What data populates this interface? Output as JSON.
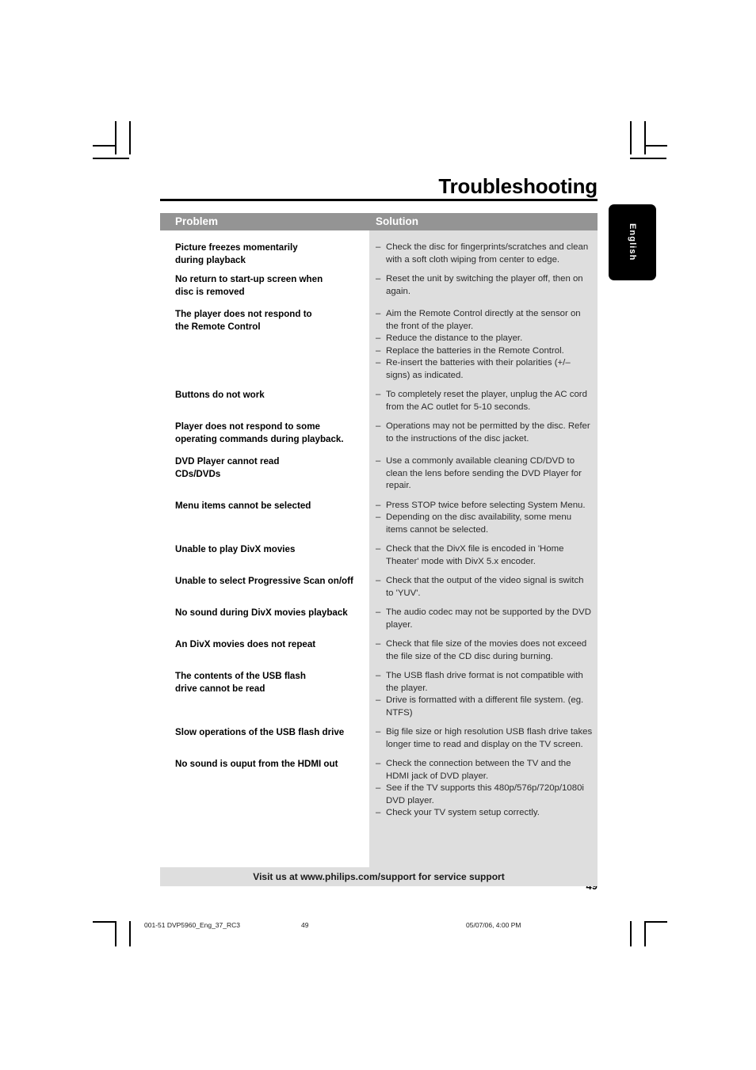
{
  "page": {
    "title": "Troubleshooting",
    "language_tab": "English",
    "page_number": "49"
  },
  "table": {
    "headers": {
      "problem": "Problem",
      "solution": "Solution"
    },
    "rows": [
      {
        "problem": "Picture freezes momentarily\nduring playback",
        "solutions": [
          "Check the disc for fingerprints/scratches and clean with a soft cloth wiping from center to edge."
        ]
      },
      {
        "problem": "No return to start-up screen when\ndisc is removed",
        "solutions": [
          "Reset the unit by switching the player off, then on again."
        ]
      },
      {
        "problem": "The player does not respond to\nthe Remote Control",
        "solutions": [
          "Aim the Remote Control directly at the sensor on the front of the player.",
          "Reduce the distance to the player.",
          "Replace the batteries in the Remote Control.",
          "Re-insert the batteries with their polarities (+/– signs) as indicated."
        ]
      },
      {
        "problem": "Buttons do not work",
        "solutions": [
          "To completely reset the player, unplug the AC cord from the AC outlet for 5-10 seconds."
        ]
      },
      {
        "problem": "Player does not respond to some\noperating commands during playback.",
        "solutions": [
          "Operations may not be permitted by the disc. Refer to the instructions of  the disc jacket."
        ]
      },
      {
        "problem": "DVD Player cannot read\nCDs/DVDs",
        "solutions": [
          "Use a commonly available cleaning CD/DVD to clean the lens before sending the DVD Player for repair."
        ]
      },
      {
        "problem": "Menu items cannot be selected",
        "solutions": [
          "Press STOP twice before selecting System Menu.",
          "Depending on the disc availability, some menu items cannot be selected."
        ]
      },
      {
        "problem": "Unable to play DivX movies",
        "solutions": [
          "Check that the DivX file is encoded in 'Home Theater' mode with DivX 5.x encoder."
        ]
      },
      {
        "problem": "Unable to select Progressive Scan on/off",
        "solutions": [
          "Check that the output of the video signal is switch to 'YUV'."
        ]
      },
      {
        "problem": "No sound during DivX movies playback",
        "solutions": [
          "The audio codec may not be supported by the DVD player."
        ]
      },
      {
        "problem": "An DivX movies does not repeat",
        "solutions": [
          "Check that file size of the movies does not exceed the file size of the CD disc during burning."
        ]
      },
      {
        "problem": "The contents of the USB flash\ndrive cannot be read",
        "solutions": [
          "The USB flash drive format is not compatible with the player.",
          "Drive is formatted with a different file system. (eg. NTFS)"
        ]
      },
      {
        "problem": "Slow operations of the USB flash drive",
        "solutions": [
          "Big file size or high resolution USB flash drive takes longer time to read and display on the TV screen."
        ]
      },
      {
        "problem": "No sound is ouput from the HDMI out",
        "solutions": [
          "Check the connection between the TV and the HDMI jack of DVD player.",
          "See if the TV supports this 480p/576p/720p/1080i DVD player.",
          "Check your TV system setup correctly."
        ]
      }
    ],
    "footer_note": "Visit us at www.philips.com/support for service support"
  },
  "prepress": {
    "file": "001-51 DVP5960_Eng_37_RC3",
    "page": "49",
    "date": "05/07/06, 4:00 PM"
  },
  "colors": {
    "header_bar": "#949494",
    "solution_wash": "#dedede",
    "tab": "#000000",
    "rule": "#000000"
  },
  "dash": "–"
}
